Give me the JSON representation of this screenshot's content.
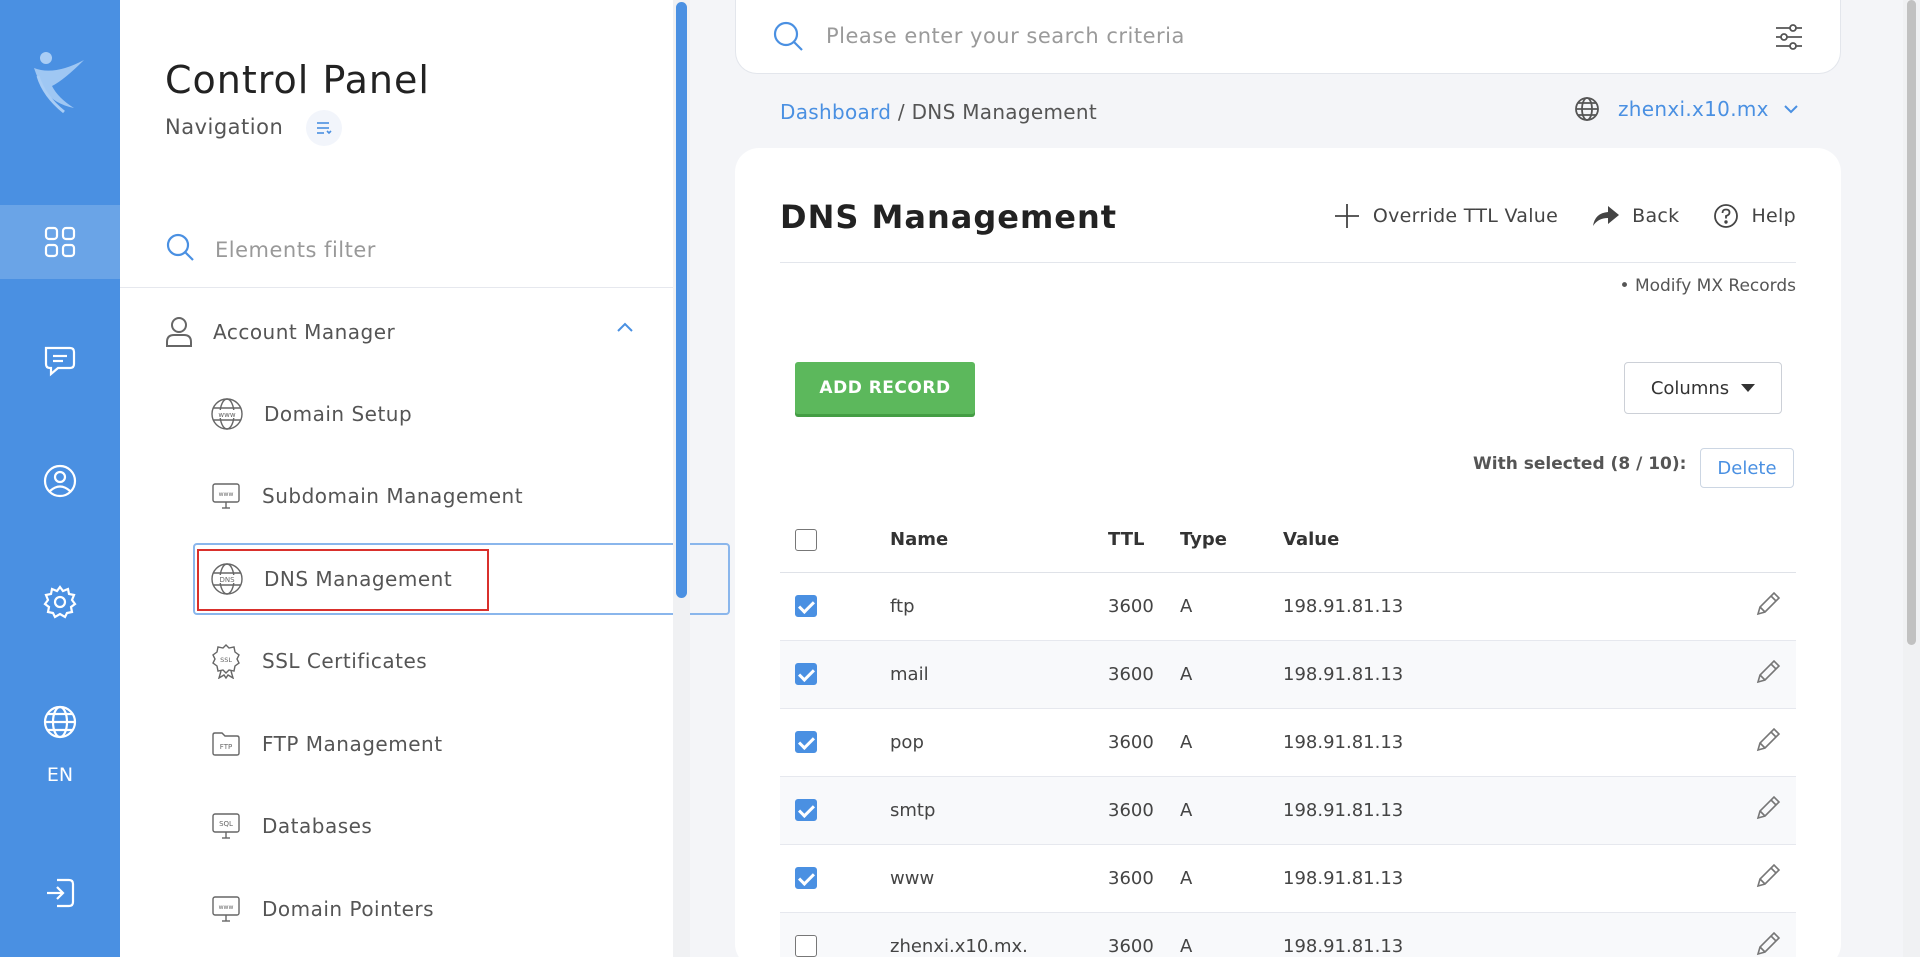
{
  "rail": {
    "items": [
      {
        "name": "dashboard",
        "icon": "grid-icon"
      },
      {
        "name": "support",
        "icon": "chat-icon"
      },
      {
        "name": "profile",
        "icon": "user-circle-icon"
      },
      {
        "name": "settings",
        "icon": "gear-icon"
      },
      {
        "name": "language",
        "icon": "globe-icon"
      },
      {
        "name": "logout",
        "icon": "logout-icon"
      }
    ],
    "language_label": "EN"
  },
  "nav": {
    "title": "Control Panel",
    "subtitle": "Navigation",
    "filter_placeholder": "Elements filter",
    "section": {
      "label": "Account Manager",
      "icon": "user-icon"
    },
    "items": [
      {
        "label": "Domain Setup",
        "icon": "www-globe-icon"
      },
      {
        "label": "Subdomain Management",
        "icon": "monitor-www-icon"
      },
      {
        "label": "DNS Management",
        "icon": "dns-globe-icon",
        "active": true
      },
      {
        "label": "SSL Certificates",
        "icon": "ssl-badge-icon"
      },
      {
        "label": "FTP Management",
        "icon": "ftp-folder-icon"
      },
      {
        "label": "Databases",
        "icon": "sql-monitor-icon"
      },
      {
        "label": "Domain Pointers",
        "icon": "monitor-www-icon"
      }
    ]
  },
  "search": {
    "placeholder": "Please enter your search criteria"
  },
  "breadcrumb": {
    "root": "Dashboard",
    "separator": "/",
    "current": "DNS Management"
  },
  "domain_select": {
    "value": "zhenxi.x10.mx"
  },
  "page": {
    "title": "DNS Management",
    "actions": {
      "override_ttl": "Override TTL Value",
      "back": "Back",
      "help": "Help"
    },
    "mx_link": "• Modify MX Records",
    "add_record": "ADD RECORD",
    "columns": "Columns",
    "with_selected": "With selected (8 / 10):",
    "delete": "Delete"
  },
  "table": {
    "headers": {
      "name": "Name",
      "ttl": "TTL",
      "type": "Type",
      "value": "Value"
    },
    "rows": [
      {
        "name": "ftp",
        "ttl": "3600",
        "type": "A",
        "value": "198.91.81.13",
        "checked": true
      },
      {
        "name": "mail",
        "ttl": "3600",
        "type": "A",
        "value": "198.91.81.13",
        "checked": true
      },
      {
        "name": "pop",
        "ttl": "3600",
        "type": "A",
        "value": "198.91.81.13",
        "checked": true
      },
      {
        "name": "smtp",
        "ttl": "3600",
        "type": "A",
        "value": "198.91.81.13",
        "checked": true
      },
      {
        "name": "www",
        "ttl": "3600",
        "type": "A",
        "value": "198.91.81.13",
        "checked": true
      },
      {
        "name": "zhenxi.x10.mx.",
        "ttl": "3600",
        "type": "A",
        "value": "198.91.81.13",
        "checked": false
      }
    ]
  },
  "colors": {
    "accent": "#4a90e2",
    "success": "#5cb85c",
    "highlight": "#d9302c"
  }
}
